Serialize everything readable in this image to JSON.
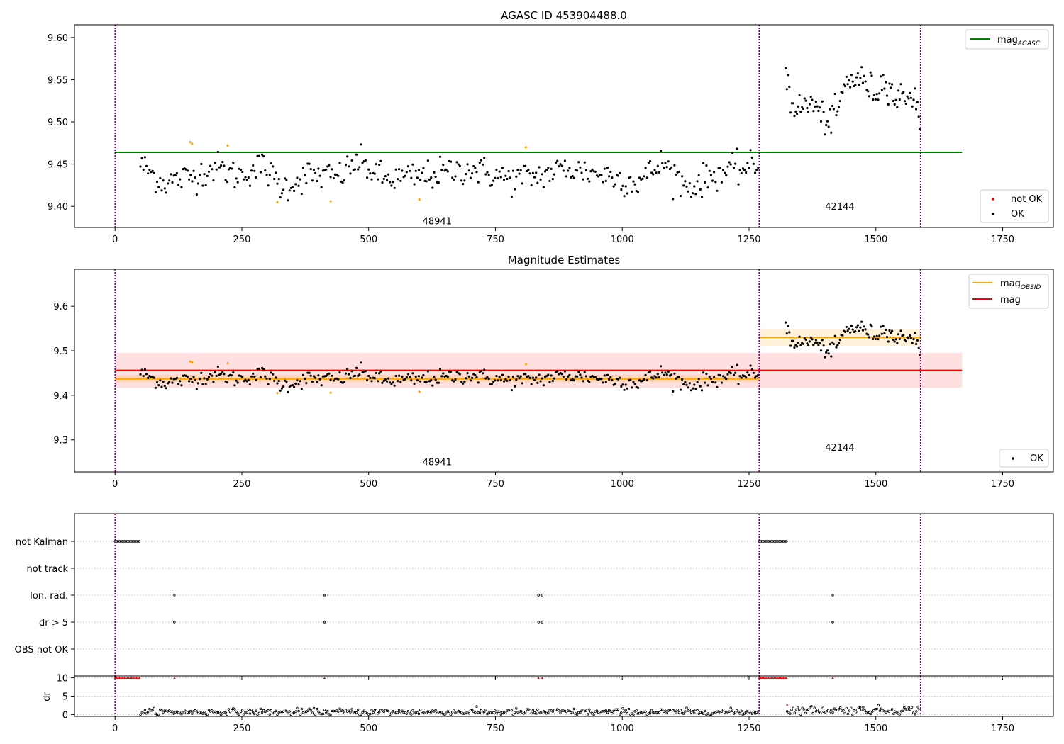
{
  "figure": {
    "background": "#ffffff",
    "observation_boundaries": [
      0,
      1270,
      1588
    ],
    "colors": {
      "agasc": "#008000",
      "obsid": "#ffa500",
      "mag": "#ff0000",
      "not_ok": "#ff0000",
      "ok": "#000000",
      "boundary": "#800080",
      "flag_points": "#000000",
      "dr_flag": "#ff0000"
    }
  },
  "chart_data": [
    {
      "type": "scatter",
      "title": "AGASC ID 453904488.0",
      "xlim": [
        -80,
        1850
      ],
      "ylim": [
        9.375,
        9.615
      ],
      "xticks": [
        0,
        250,
        500,
        750,
        1000,
        1250,
        1500,
        1750
      ],
      "yticks": [
        9.4,
        9.45,
        9.5,
        9.55,
        9.6
      ],
      "ytick_labels": [
        "9.40",
        "9.45",
        "9.50",
        "9.55",
        "9.60"
      ],
      "grid": false,
      "legend_upper": {
        "position": "top-right",
        "entries": [
          {
            "label": "mag",
            "subscript": "AGASC",
            "kind": "line",
            "color": "#008000"
          }
        ]
      },
      "legend_lower": {
        "position": "bottom-right",
        "entries": [
          {
            "label": "not OK",
            "kind": "point",
            "color": "#ff0000"
          },
          {
            "label": "OK",
            "kind": "point",
            "color": "#000000"
          }
        ]
      },
      "hlines": [
        {
          "name": "mag_AGASC",
          "y": 9.464,
          "x": [
            0,
            1670
          ],
          "color": "#008000"
        }
      ],
      "obsid_labels": [
        {
          "text": "48941",
          "x": 635,
          "y": 9.383
        },
        {
          "text": "42144",
          "x": 1429,
          "y": 9.4
        }
      ],
      "series": [
        {
          "name": "OK",
          "color": "#000000",
          "segments": [
            {
              "x_start": 50,
              "x_end": 1270,
              "step": 3,
              "centers": [
                [
                  50,
                  9.45
                ],
                [
                  95,
                  9.428
                ],
                [
                  150,
                  9.435
                ],
                [
                  200,
                  9.447
                ],
                [
                  240,
                  9.436
                ],
                [
                  290,
                  9.448
                ],
                [
                  330,
                  9.422
                ],
                [
                  380,
                  9.437
                ],
                [
                  440,
                  9.435
                ],
                [
                  480,
                  9.453
                ],
                [
                  530,
                  9.432
                ],
                [
                  600,
                  9.435
                ],
                [
                  700,
                  9.445
                ],
                [
                  780,
                  9.432
                ],
                [
                  840,
                  9.437
                ],
                [
                  890,
                  9.445
                ],
                [
                  960,
                  9.438
                ],
                [
                  1030,
                  9.428
                ],
                [
                  1080,
                  9.452
                ],
                [
                  1130,
                  9.422
                ],
                [
                  1190,
                  9.44
                ],
                [
                  1270,
                  9.448
                ]
              ],
              "spread": 0.009
            },
            {
              "x_start": 1322,
              "x_end": 1588,
              "step": 2.5,
              "centers": [
                [
                  1322,
                  9.565
                ],
                [
                  1332,
                  9.525
                ],
                [
                  1350,
                  9.515
                ],
                [
                  1375,
                  9.523
                ],
                [
                  1395,
                  9.505
                ],
                [
                  1410,
                  9.5
                ],
                [
                  1425,
                  9.513
                ],
                [
                  1440,
                  9.545
                ],
                [
                  1465,
                  9.553
                ],
                [
                  1480,
                  9.545
                ],
                [
                  1500,
                  9.535
                ],
                [
                  1520,
                  9.553
                ],
                [
                  1540,
                  9.525
                ],
                [
                  1560,
                  9.535
                ],
                [
                  1575,
                  9.53
                ],
                [
                  1588,
                  9.492
                ]
              ],
              "spread": 0.009
            }
          ]
        },
        {
          "name": "not OK",
          "color": "#ffa500",
          "points": [
            [
              148,
              9.476
            ],
            [
              152,
              9.474
            ],
            [
              222,
              9.472
            ],
            [
              320,
              9.405
            ],
            [
              425,
              9.406
            ],
            [
              600,
              9.408
            ],
            [
              810,
              9.47
            ]
          ]
        }
      ]
    },
    {
      "type": "scatter",
      "title": "Magnitude Estimates",
      "xlim": [
        -80,
        1850
      ],
      "ylim": [
        9.228,
        9.683
      ],
      "xticks": [
        0,
        250,
        500,
        750,
        1000,
        1250,
        1500,
        1750
      ],
      "yticks": [
        9.3,
        9.4,
        9.5,
        9.6
      ],
      "ytick_labels": [
        "9.3",
        "9.4",
        "9.5",
        "9.6"
      ],
      "grid": false,
      "legend_upper": {
        "position": "top-right",
        "entries": [
          {
            "label": "mag",
            "subscript": "OBSID",
            "kind": "line",
            "color": "#ffa500"
          },
          {
            "label": "mag",
            "subscript": "",
            "kind": "line",
            "color": "#ff0000"
          }
        ]
      },
      "legend_lower": {
        "position": "bottom-right",
        "entries": [
          {
            "label": "OK",
            "kind": "point",
            "color": "#000000"
          }
        ]
      },
      "bands": [
        {
          "name": "mag",
          "x": [
            0,
            1670
          ],
          "y": [
            9.417,
            9.495
          ],
          "color": "#ff0000",
          "opacity": 0.12
        },
        {
          "name": "mag_OBSID 48941",
          "x": [
            0,
            1270
          ],
          "y": [
            9.43,
            9.446
          ],
          "color": "#ffa500",
          "opacity": 0.18
        },
        {
          "name": "mag_OBSID 42144",
          "x": [
            1270,
            1588
          ],
          "y": [
            9.511,
            9.549
          ],
          "color": "#ffa500",
          "opacity": 0.15
        }
      ],
      "hlines": [
        {
          "name": "mag",
          "y": 9.456,
          "x": [
            0,
            1670
          ],
          "color": "#ff0000"
        },
        {
          "name": "mag_OBSID 48941",
          "y": 9.437,
          "x": [
            0,
            1270
          ],
          "color": "#ffa500"
        },
        {
          "name": "mag_OBSID 42144",
          "y": 9.53,
          "x": [
            1270,
            1588
          ],
          "color": "#ffa500"
        }
      ],
      "obsid_labels": [
        {
          "text": "48941",
          "x": 635,
          "y": 9.251
        },
        {
          "text": "42144",
          "x": 1429,
          "y": 9.284
        }
      ],
      "series_from_panel": 0
    },
    {
      "type": "scatter",
      "title": "",
      "xlim": [
        -80,
        1850
      ],
      "rows": [
        "not Kalman",
        "not track",
        "Ion. rad.",
        "dr > 5",
        "OBS not OK"
      ],
      "grid": "dotted horizontal",
      "flag_points": {
        "not Kalman": {
          "ranges": [
            [
              0,
              50
            ],
            [
              1270,
              1325
            ]
          ],
          "step": 3,
          "points": []
        },
        "not track": {
          "ranges": [],
          "points": []
        },
        "Ion. rad.": {
          "ranges": [],
          "points": [
            117,
            413,
            835,
            842,
            1415
          ]
        },
        "dr > 5": {
          "ranges": [],
          "points": [
            117,
            413,
            835,
            842,
            1415
          ]
        },
        "OBS not OK": {
          "ranges": [],
          "points": []
        }
      }
    },
    {
      "type": "scatter",
      "title": "",
      "ylabel": "dr",
      "xlim": [
        -80,
        1850
      ],
      "ylim": [
        -0.5,
        10.5
      ],
      "xticks": [
        0,
        250,
        500,
        750,
        1000,
        1250,
        1500,
        1750
      ],
      "yticks": [
        0,
        5,
        10
      ],
      "ytick_labels": [
        "0",
        "5",
        "10"
      ],
      "grid": "dotted horizontal",
      "capped_points": {
        "y": 10,
        "color": "#ff0000",
        "ranges": [
          [
            0,
            50
          ],
          [
            1270,
            1325
          ]
        ],
        "step": 3,
        "points": [
          117,
          413,
          835,
          842,
          1415
        ]
      },
      "dr_segments": [
        {
          "x_start": 50,
          "x_end": 1270,
          "step": 3,
          "level": 0.7,
          "spread": 0.45
        },
        {
          "x_start": 1325,
          "x_end": 1588,
          "step": 3,
          "level": 1.2,
          "spread": 0.55
        }
      ],
      "dr_highlight": {
        "x": 1325,
        "y": 2.7,
        "color": "#ff0000"
      }
    }
  ]
}
